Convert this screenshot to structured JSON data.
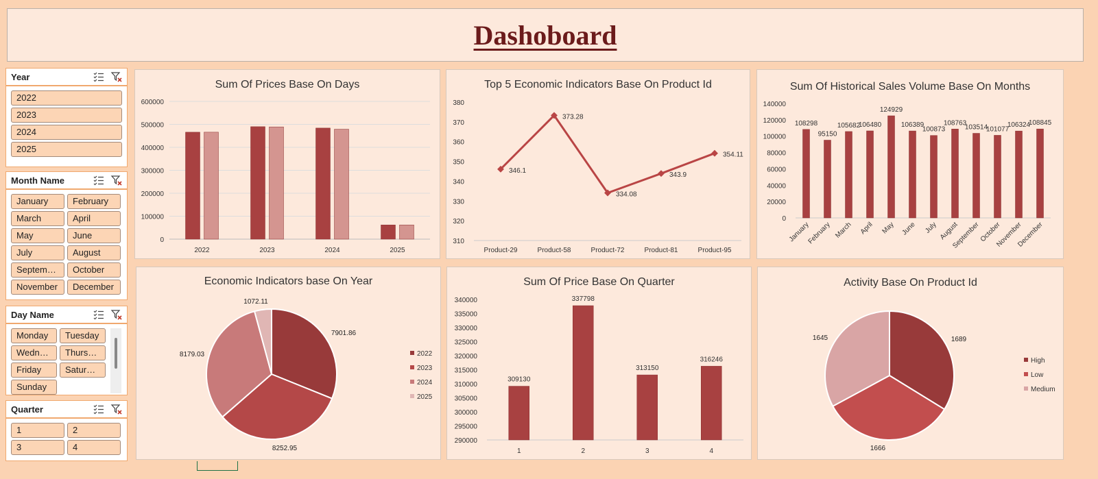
{
  "header": {
    "title": "Dashoboard"
  },
  "slicers": {
    "year": {
      "title": "Year",
      "items": [
        "2022",
        "2023",
        "2024",
        "2025"
      ]
    },
    "month": {
      "title": "Month Name",
      "items": [
        "January",
        "February",
        "March",
        "April",
        "May",
        "June",
        "July",
        "August",
        "September",
        "October",
        "November",
        "December"
      ]
    },
    "day": {
      "title": "Day Name",
      "items": [
        "Monday",
        "Tuesday",
        "Wedne...",
        "Thursday",
        "Friday",
        "Saturday",
        "Sunday"
      ]
    },
    "quarter": {
      "title": "Quarter",
      "items": [
        "1",
        "2",
        "3",
        "4"
      ]
    }
  },
  "colors": {
    "background": "#fbd3b3",
    "panel": "#fde9dc",
    "dark_red": "#a84141",
    "light_red": "#d49590",
    "title_text": "#6b1b1b"
  },
  "chart_data": [
    {
      "id": "prices-days",
      "type": "bar",
      "title": "Sum Of Prices Base On Days",
      "categories": [
        "2022",
        "2023",
        "2024",
        "2025"
      ],
      "series": [
        {
          "values": [
            466000,
            490000,
            484000,
            62000
          ]
        },
        {
          "values": [
            466000,
            489000,
            479000,
            62000
          ]
        }
      ],
      "ylim": [
        0,
        600000
      ],
      "yticks": [
        "0",
        "100000",
        "200000",
        "300000",
        "400000",
        "500000",
        "600000"
      ],
      "grid": true
    },
    {
      "id": "econ-product",
      "type": "line",
      "title": "Top 5 Economic Indicators Base On Product Id",
      "categories": [
        "Product-29",
        "Product-58",
        "Product-72",
        "Product-81",
        "Product-95"
      ],
      "values": [
        346.1,
        373.28,
        334.08,
        343.9,
        354.11
      ],
      "labels": [
        "346.1",
        "373.28",
        "334.08",
        "343.9",
        "354.11"
      ],
      "ylim": [
        310,
        380
      ],
      "yticks": [
        "310",
        "320",
        "330",
        "340",
        "350",
        "360",
        "370",
        "380"
      ],
      "grid": false
    },
    {
      "id": "sales-months",
      "type": "bar",
      "title": "Sum Of Historical Sales Volume Base On Months",
      "categories": [
        "January",
        "February",
        "March",
        "April",
        "May",
        "June",
        "July",
        "August",
        "September",
        "October",
        "November",
        "December"
      ],
      "values": [
        108298,
        95150,
        105682,
        106480,
        124929,
        106389,
        100873,
        108763,
        103514,
        101077,
        106324,
        108845
      ],
      "labels": [
        "108298",
        "95150",
        "105682",
        "106480",
        "124929",
        "106389",
        "100873",
        "108763",
        "103514",
        "101077",
        "106324",
        "108845"
      ],
      "ylim": [
        0,
        140000
      ],
      "yticks": [
        "0",
        "20000",
        "40000",
        "60000",
        "80000",
        "100000",
        "120000",
        "140000"
      ],
      "grid": false
    },
    {
      "id": "econ-year",
      "type": "pie",
      "title": "Economic Indicators base On Year",
      "categories": [
        "2022",
        "2023",
        "2024",
        "2025"
      ],
      "values": [
        7901.86,
        8252.95,
        8179.03,
        1072.11
      ],
      "labels": [
        "7901.86",
        "8252.95",
        "8179.03",
        "1072.11"
      ],
      "colors": [
        "#983a3a",
        "#b44848",
        "#c87a7a",
        "#e0b6b4"
      ],
      "legend": "right"
    },
    {
      "id": "price-quarter",
      "type": "bar",
      "title": "Sum Of Price Base On Quarter",
      "categories": [
        "1",
        "2",
        "3",
        "4"
      ],
      "values": [
        309130,
        337798,
        313150,
        316246
      ],
      "labels": [
        "309130",
        "337798",
        "313150",
        "316246"
      ],
      "ylim": [
        290000,
        340000
      ],
      "yticks": [
        "290000",
        "295000",
        "300000",
        "305000",
        "310000",
        "315000",
        "320000",
        "325000",
        "330000",
        "335000",
        "340000"
      ],
      "grid": false
    },
    {
      "id": "activity-product",
      "type": "pie",
      "title": "Activity Base On Product Id",
      "categories": [
        "High",
        "Low",
        "Medium"
      ],
      "values": [
        1689,
        1666,
        1645
      ],
      "labels": [
        "1689",
        "1666",
        "1645"
      ],
      "colors": [
        "#983a3a",
        "#c24e4e",
        "#d9a5a5"
      ],
      "legend": "right"
    }
  ]
}
